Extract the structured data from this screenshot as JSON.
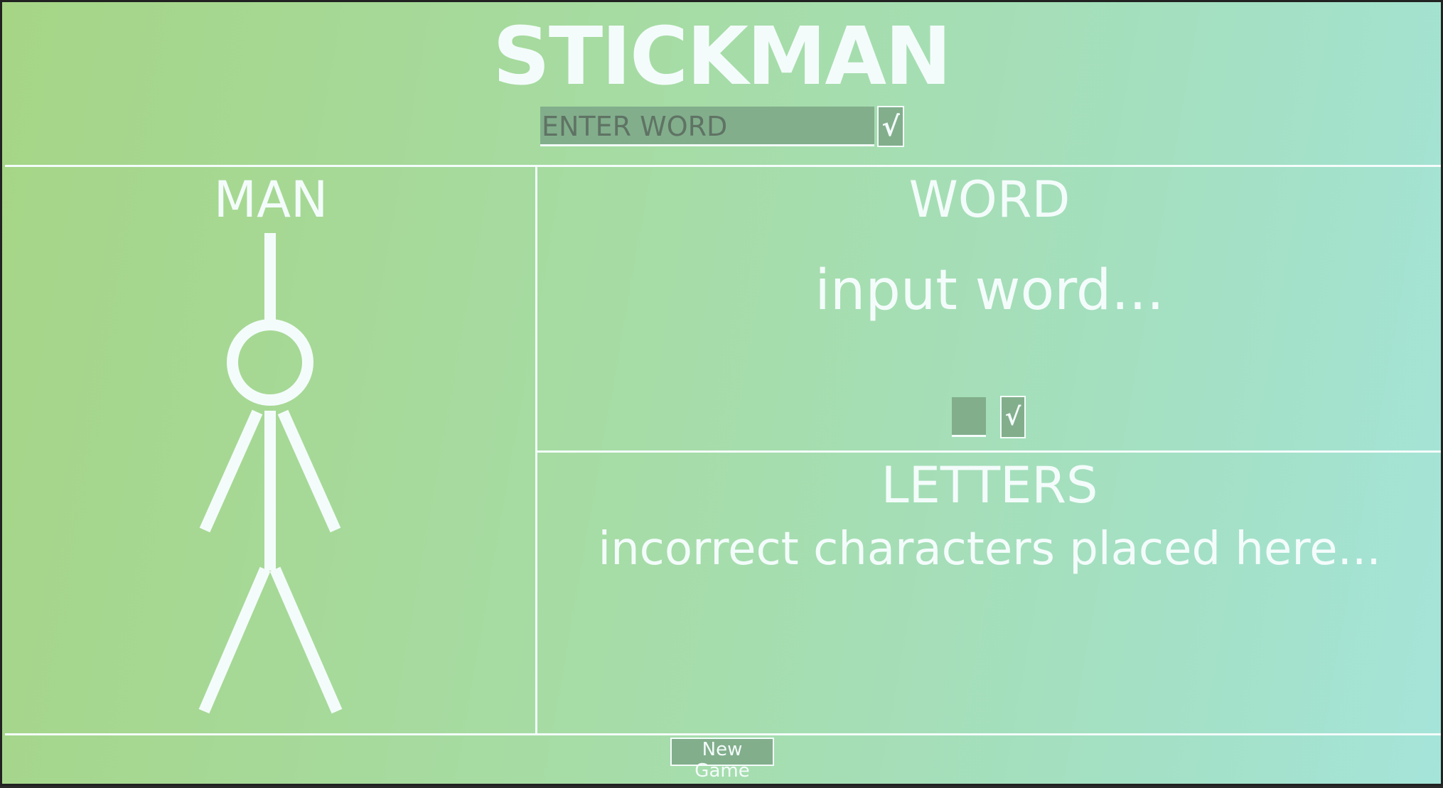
{
  "header": {
    "title": "STICKMAN",
    "word_input_placeholder": "ENTER WORD",
    "submit_word_label": "√"
  },
  "man_panel": {
    "heading": "MAN",
    "parts_drawn": [
      "rope",
      "head",
      "body",
      "left-arm",
      "right-arm",
      "left-leg",
      "right-leg"
    ]
  },
  "word_panel": {
    "heading": "WORD",
    "display_text": "input word...",
    "letter_input_value": "",
    "submit_letter_label": "√"
  },
  "letters_panel": {
    "heading": "LETTERS",
    "display_text": "incorrect characters placed here..."
  },
  "footer": {
    "new_game_label": "New Game"
  },
  "colors": {
    "background_start": "#a6d586",
    "background_end": "#a5e4d9",
    "foreground": "#f4fcfb",
    "input_fill": "#82ae8c"
  }
}
